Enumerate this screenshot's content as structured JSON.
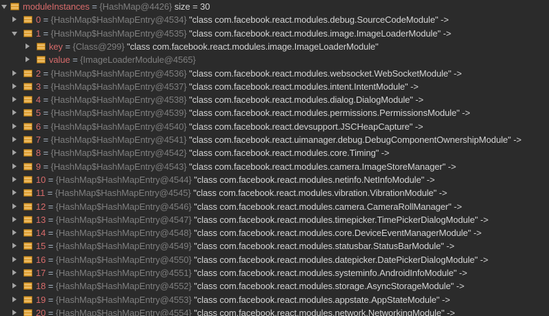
{
  "root": {
    "name": "moduleInstances",
    "ref": "{HashMap@4426}",
    "size_label": "size = 30"
  },
  "entries": [
    {
      "index": "0",
      "ref": "{HashMap$HashMapEntry@4534}",
      "value": "\"class com.facebook.react.modules.debug.SourceCodeModule\" ->",
      "expanded": false
    },
    {
      "index": "1",
      "ref": "{HashMap$HashMapEntry@4535}",
      "value": "\"class com.facebook.react.modules.image.ImageLoaderModule\" ->",
      "expanded": true,
      "children": [
        {
          "name": "key",
          "ref": "{Class@299}",
          "value": "\"class com.facebook.react.modules.image.ImageLoaderModule\""
        },
        {
          "name": "value",
          "ref": "{ImageLoaderModule@4565}",
          "value": ""
        }
      ]
    },
    {
      "index": "2",
      "ref": "{HashMap$HashMapEntry@4536}",
      "value": "\"class com.facebook.react.modules.websocket.WebSocketModule\" ->",
      "expanded": false
    },
    {
      "index": "3",
      "ref": "{HashMap$HashMapEntry@4537}",
      "value": "\"class com.facebook.react.modules.intent.IntentModule\" ->",
      "expanded": false
    },
    {
      "index": "4",
      "ref": "{HashMap$HashMapEntry@4538}",
      "value": "\"class com.facebook.react.modules.dialog.DialogModule\" ->",
      "expanded": false
    },
    {
      "index": "5",
      "ref": "{HashMap$HashMapEntry@4539}",
      "value": "\"class com.facebook.react.modules.permissions.PermissionsModule\" ->",
      "expanded": false
    },
    {
      "index": "6",
      "ref": "{HashMap$HashMapEntry@4540}",
      "value": "\"class com.facebook.react.devsupport.JSCHeapCapture\" ->",
      "expanded": false
    },
    {
      "index": "7",
      "ref": "{HashMap$HashMapEntry@4541}",
      "value": "\"class com.facebook.react.uimanager.debug.DebugComponentOwnershipModule\" ->",
      "expanded": false
    },
    {
      "index": "8",
      "ref": "{HashMap$HashMapEntry@4542}",
      "value": "\"class com.facebook.react.modules.core.Timing\" ->",
      "expanded": false
    },
    {
      "index": "9",
      "ref": "{HashMap$HashMapEntry@4543}",
      "value": "\"class com.facebook.react.modules.camera.ImageStoreManager\" ->",
      "expanded": false
    },
    {
      "index": "10",
      "ref": "{HashMap$HashMapEntry@4544}",
      "value": "\"class com.facebook.react.modules.netinfo.NetInfoModule\" ->",
      "expanded": false
    },
    {
      "index": "11",
      "ref": "{HashMap$HashMapEntry@4545}",
      "value": "\"class com.facebook.react.modules.vibration.VibrationModule\" ->",
      "expanded": false
    },
    {
      "index": "12",
      "ref": "{HashMap$HashMapEntry@4546}",
      "value": "\"class com.facebook.react.modules.camera.CameraRollManager\" ->",
      "expanded": false
    },
    {
      "index": "13",
      "ref": "{HashMap$HashMapEntry@4547}",
      "value": "\"class com.facebook.react.modules.timepicker.TimePickerDialogModule\" ->",
      "expanded": false
    },
    {
      "index": "14",
      "ref": "{HashMap$HashMapEntry@4548}",
      "value": "\"class com.facebook.react.modules.core.DeviceEventManagerModule\" ->",
      "expanded": false
    },
    {
      "index": "15",
      "ref": "{HashMap$HashMapEntry@4549}",
      "value": "\"class com.facebook.react.modules.statusbar.StatusBarModule\" ->",
      "expanded": false
    },
    {
      "index": "16",
      "ref": "{HashMap$HashMapEntry@4550}",
      "value": "\"class com.facebook.react.modules.datepicker.DatePickerDialogModule\" ->",
      "expanded": false
    },
    {
      "index": "17",
      "ref": "{HashMap$HashMapEntry@4551}",
      "value": "\"class com.facebook.react.modules.systeminfo.AndroidInfoModule\" ->",
      "expanded": false
    },
    {
      "index": "18",
      "ref": "{HashMap$HashMapEntry@4552}",
      "value": "\"class com.facebook.react.modules.storage.AsyncStorageModule\" ->",
      "expanded": false
    },
    {
      "index": "19",
      "ref": "{HashMap$HashMapEntry@4553}",
      "value": "\"class com.facebook.react.modules.appstate.AppStateModule\" ->",
      "expanded": false
    },
    {
      "index": "20",
      "ref": "{HashMap$HashMapEntry@4554}",
      "value": "\"class com.facebook.react.modules.network.NetworkingModule\" ->",
      "expanded": false
    }
  ],
  "colors": {
    "background": "#2b2b2b",
    "field_name": "#d76b6b",
    "reference": "#7f7f7f",
    "value_text": "#d4d4d4",
    "icon": "#e0a33a"
  },
  "icons": {
    "expanded": "triangle-down-icon",
    "collapsed": "triangle-right-icon",
    "field": "field-icon"
  }
}
